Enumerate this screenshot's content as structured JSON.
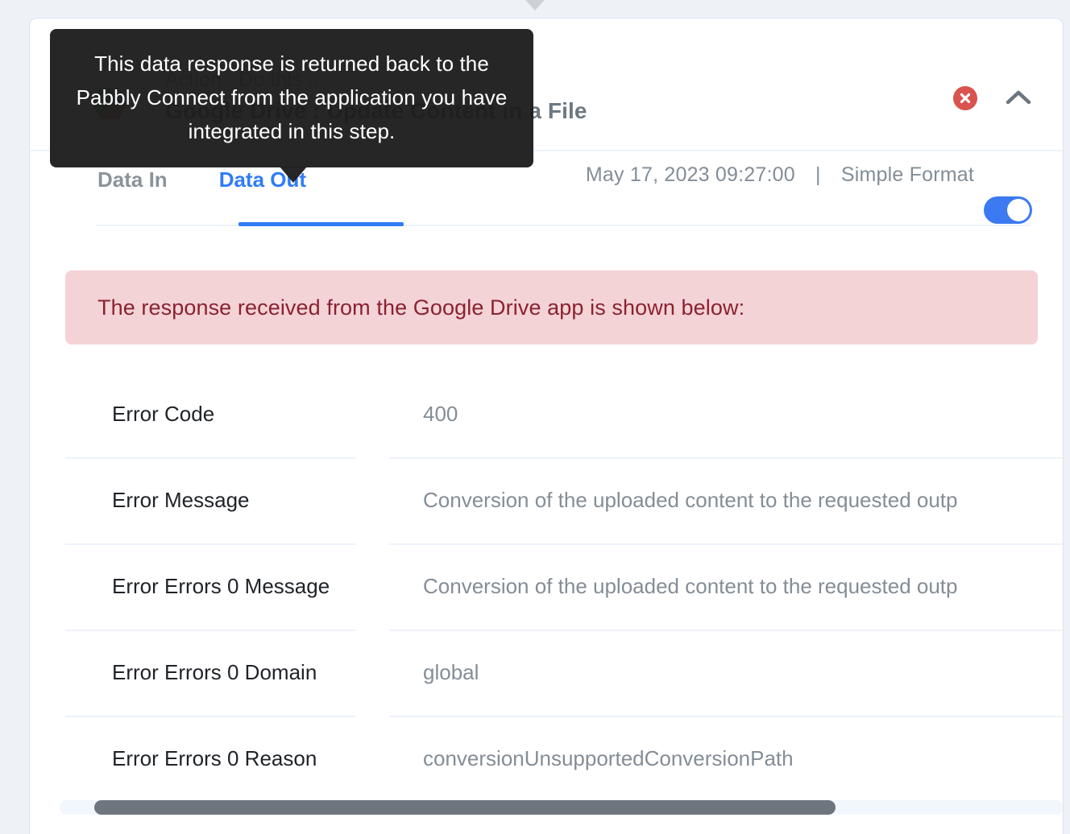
{
  "window": {
    "background_color": "#eef2f7",
    "card_background": "#ffffff"
  },
  "tooltip": {
    "text": "This data response is returned back to the Pabbly Connect from the application you have integrated in this step."
  },
  "header": {
    "app_logo_name": "google-drive-logo",
    "subtitle": "Action : Do this ...",
    "title": "Google Drive : Update Content in a File",
    "error_badge_label": "✕",
    "error_badge_color": "#d9534f",
    "collapse_icon": "chevron-up-icon"
  },
  "tabs": {
    "items": [
      {
        "label": "Data In",
        "active": false
      },
      {
        "label": "Data Out",
        "active": true
      }
    ],
    "active_color": "#2f7cf6",
    "meta_timestamp": "May 17, 2023 09:27:00",
    "meta_separator": "|",
    "meta_format": "Simple Format",
    "toggle_state": "on",
    "toggle_color": "#3b7af0"
  },
  "alert": {
    "message": "The response received from the Google Drive app is shown below:",
    "background_color": "#f4d3d7",
    "text_color": "#8a2230"
  },
  "data_table": {
    "rows": [
      {
        "key": "Error Code",
        "value": "400"
      },
      {
        "key": "Error Message",
        "value": "Conversion of the uploaded content to the requested outp"
      },
      {
        "key": "Error Errors 0 Message",
        "value": "Conversion of the uploaded content to the requested outp"
      },
      {
        "key": "Error Errors 0 Domain",
        "value": "global"
      },
      {
        "key": "Error Errors 0 Reason",
        "value": "conversionUnsupportedConversionPath"
      }
    ]
  },
  "scrollbar": {
    "orientation": "horizontal",
    "thumb_color": "#6e757e",
    "track_color": "#f2f7fd"
  }
}
